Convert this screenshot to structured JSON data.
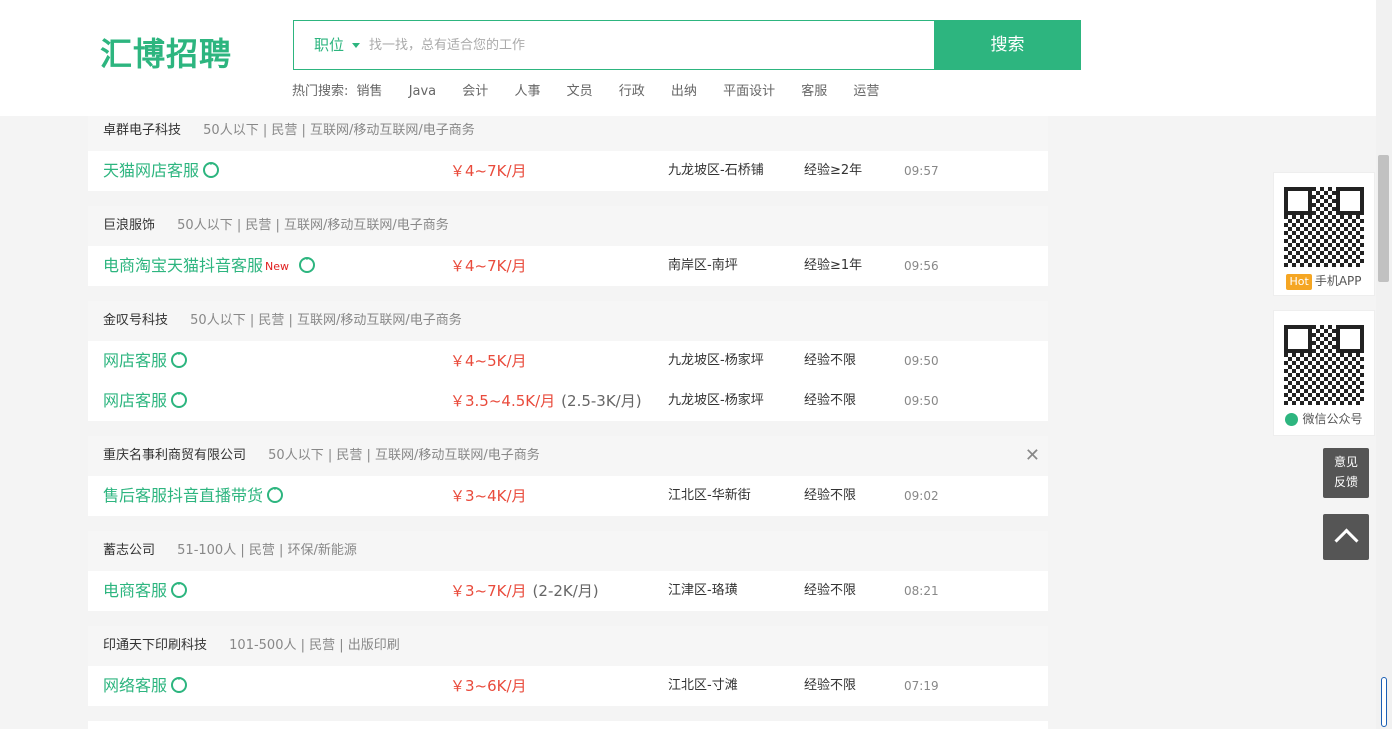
{
  "header": {
    "logo": "汇博招聘",
    "search_category": "职位",
    "search_placeholder": "找一找，总有适合您的工作",
    "search_button": "搜索",
    "hot_label": "热门搜索:",
    "hot_items": [
      "销售",
      "Java",
      "会计",
      "人事",
      "文员",
      "行政",
      "出纳",
      "平面设计",
      "客服",
      "运营"
    ]
  },
  "companies": [
    {
      "name": "卓群电子科技",
      "info": "50人以下 | 民营 | 互联网/移动互联网/电子商务",
      "jobs": [
        {
          "title": "天猫网店客服",
          "is_new": false,
          "salary": "￥4~7K/月",
          "salary_sub": "",
          "location": "九龙坡区-石桥铺",
          "exp": "经验≥2年",
          "time": "09:57"
        }
      ]
    },
    {
      "name": "巨浪服饰",
      "info": "50人以下 | 民营 | 互联网/移动互联网/电子商务",
      "jobs": [
        {
          "title": "电商淘宝天猫抖音客服",
          "is_new": true,
          "new_label": "New",
          "salary": "￥4~7K/月",
          "salary_sub": "",
          "location": "南岸区-南坪",
          "exp": "经验≥1年",
          "time": "09:56"
        }
      ]
    },
    {
      "name": "金叹号科技",
      "info": "50人以下 | 民营 | 互联网/移动互联网/电子商务",
      "jobs": [
        {
          "title": "网店客服",
          "is_new": false,
          "salary": "￥4~5K/月",
          "salary_sub": "",
          "location": "九龙坡区-杨家坪",
          "exp": "经验不限",
          "time": "09:50"
        },
        {
          "title": "网店客服",
          "is_new": false,
          "salary": "￥3.5~4.5K/月",
          "salary_sub": "(2.5-3K/月)",
          "location": "九龙坡区-杨家坪",
          "exp": "经验不限",
          "time": "09:50"
        }
      ]
    },
    {
      "name": "重庆名事利商贸有限公司",
      "info": "50人以下 | 民营 | 互联网/移动互联网/电子商务",
      "closable": true,
      "jobs": [
        {
          "title": "售后客服抖音直播带货",
          "is_new": false,
          "salary": "￥3~4K/月",
          "salary_sub": "",
          "location": "江北区-华新街",
          "exp": "经验不限",
          "time": "09:02"
        }
      ]
    },
    {
      "name": "蓄志公司",
      "info": "51-100人 | 民营 | 环保/新能源",
      "jobs": [
        {
          "title": "电商客服",
          "is_new": false,
          "salary": "￥3~7K/月",
          "salary_sub": "(2-2K/月)",
          "location": "江津区-珞璜",
          "exp": "经验不限",
          "time": "08:21"
        }
      ]
    },
    {
      "name": "印通天下印刷科技",
      "info": "101-500人 | 民营 | 出版印刷",
      "jobs": [
        {
          "title": "网络客服",
          "is_new": false,
          "salary": "￥3~6K/月",
          "salary_sub": "",
          "location": "江北区-寸滩",
          "exp": "经验不限",
          "time": "07:19"
        }
      ]
    }
  ],
  "side": {
    "app_hot": "Hot",
    "app_label": "手机APP",
    "wechat_label": "微信公众号",
    "feedback_line1": "意见",
    "feedback_line2": "反馈"
  },
  "colors": {
    "brand": "#2db57f",
    "salary": "#e94b3c",
    "new": "#e02020"
  }
}
